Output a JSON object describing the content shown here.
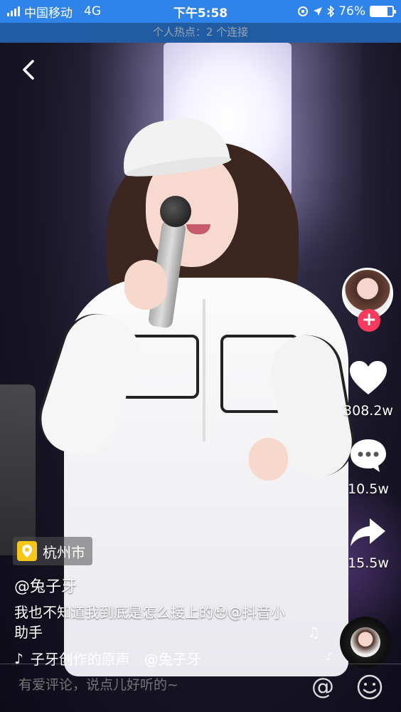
{
  "status_bar": {
    "carrier": "中国移动",
    "network": "4G",
    "time": "下午5:58",
    "battery_percent": "76%",
    "battery_level": 0.76
  },
  "hotspot": {
    "text": "个人热点：2 个连接"
  },
  "author": {
    "username": "@兔子牙",
    "location": "杭州市"
  },
  "caption": "我也不知道我到底是怎么接上的😳@抖音小助手",
  "music": {
    "text": "子牙创作的原声　@兔子牙"
  },
  "actions": {
    "likes": "308.2w",
    "comments": "10.5w",
    "shares": "15.5w",
    "follow_label": "+"
  },
  "comment_bar": {
    "placeholder": "有爱评论，说点儿好听的~",
    "at_label": "@"
  },
  "colors": {
    "status_bar_bg": "#2f83e9",
    "follow_red": "#f53a5e",
    "location_yellow": "#f5c518"
  }
}
